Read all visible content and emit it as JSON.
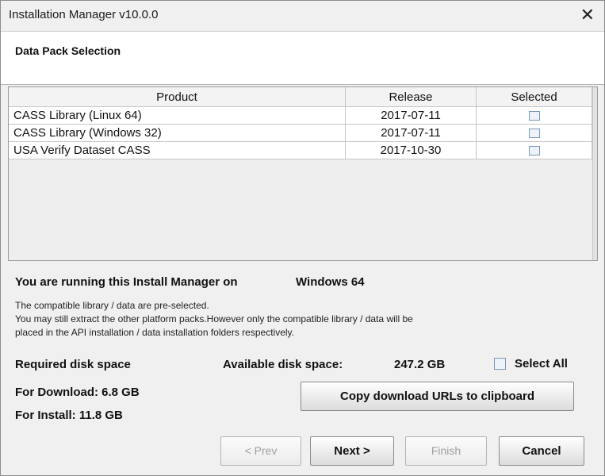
{
  "window": {
    "title": "Installation Manager v10.0.0",
    "close_glyph": "✕"
  },
  "header": {
    "title": "Data Pack Selection"
  },
  "table": {
    "columns": [
      "Product",
      "Release",
      "Selected"
    ],
    "rows": [
      {
        "product": "CASS Library (Linux 64)",
        "release": "2017-07-11",
        "selected": false
      },
      {
        "product": "CASS Library (Windows 32)",
        "release": "2017-07-11",
        "selected": false
      },
      {
        "product": "USA Verify Dataset CASS",
        "release": "2017-10-30",
        "selected": false
      }
    ]
  },
  "info": {
    "running_label": "You are running this Install Manager on",
    "os": "Windows 64",
    "line1": "The compatible library / data are pre-selected.",
    "line2": "You may still extract the other platform packs.However only the compatible library / data will be",
    "line3": "placed in the API installation / data installation folders respectively."
  },
  "disk": {
    "required_label": "Required disk space",
    "available_label": "Available disk space:",
    "available_value": "247.2 GB",
    "download": "For Download: 6.8 GB",
    "install": "For Install: 11.8 GB"
  },
  "select_all": {
    "label": "Select All",
    "checked": false
  },
  "buttons": {
    "copy": "Copy download URLs to clipboard",
    "prev": "< Prev",
    "next": "Next >",
    "finish": "Finish",
    "cancel": "Cancel"
  }
}
